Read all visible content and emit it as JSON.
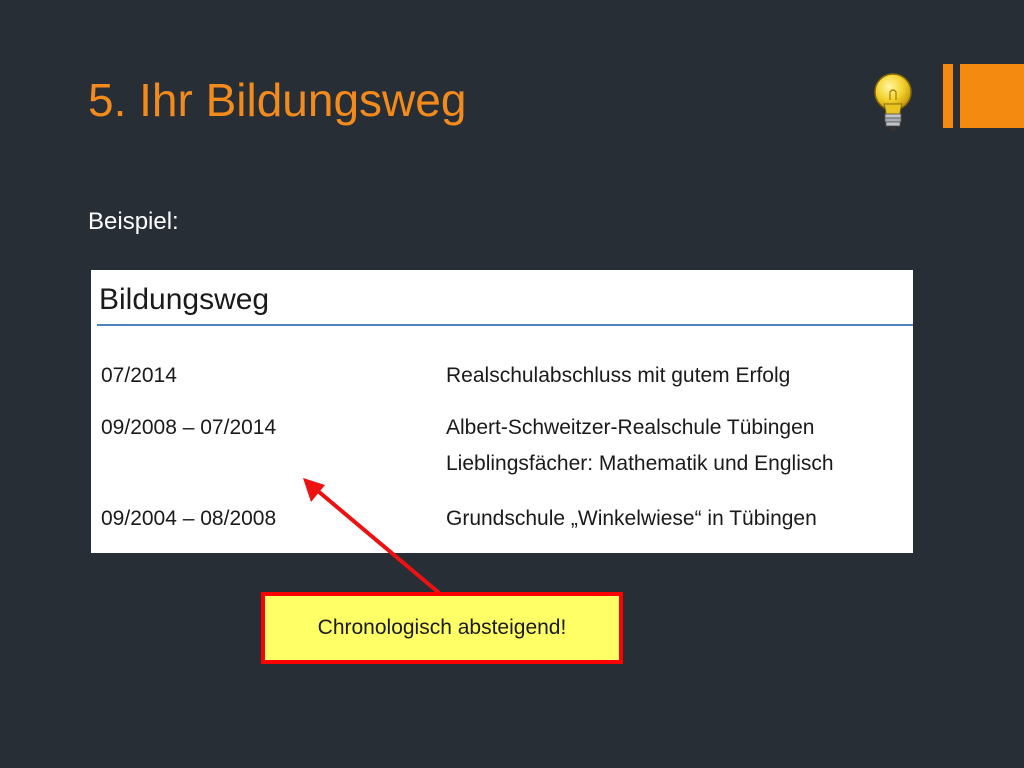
{
  "slide": {
    "title": "5. Ihr Bildungsweg",
    "intro": "Beispiel:",
    "icon": "lightbulb-icon",
    "colors": {
      "background": "#282e36",
      "title": "#f28a1c",
      "accent": "#f58a10",
      "callout_fill": "#ffff66",
      "callout_border": "#ff0000",
      "arrow": "#ee1111"
    }
  },
  "cv_image": {
    "heading": "Bildungsweg",
    "entries": [
      {
        "date": "07/2014",
        "lines": [
          "Realschulabschluss mit gutem Erfolg"
        ]
      },
      {
        "date": "09/2008 – 07/2014",
        "lines": [
          "Albert-Schweitzer-Realschule Tübingen",
          "Lieblingsfächer: Mathematik und Englisch"
        ]
      },
      {
        "date": "09/2004 – 08/2008",
        "lines": [
          "Grundschule „Winkelwiese“ in Tübingen"
        ]
      }
    ]
  },
  "callout": {
    "text": "Chronologisch absteigend!"
  }
}
